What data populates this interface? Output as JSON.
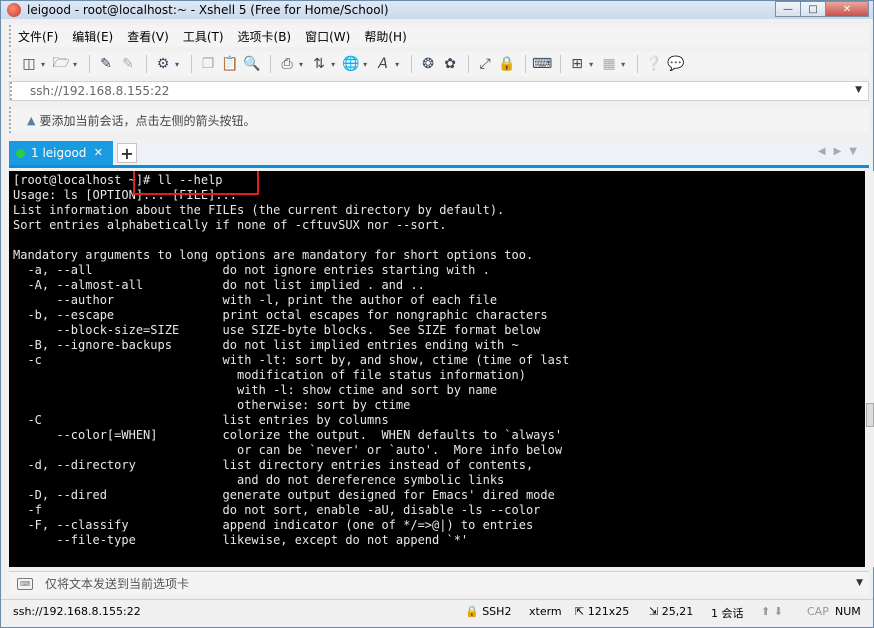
{
  "window": {
    "title": "leigood - root@localhost:~ - Xshell 5 (Free for Home/School)"
  },
  "menu": [
    "文件(F)",
    "编辑(E)",
    "查看(V)",
    "工具(T)",
    "选项卡(B)",
    "窗口(W)",
    "帮助(H)"
  ],
  "address": {
    "value": "ssh://192.168.8.155:22"
  },
  "hint": {
    "text": "要添加当前会话，点击左侧的箭头按钮。"
  },
  "tabs": [
    {
      "label": "1 leigood",
      "active": true
    }
  ],
  "terminal": {
    "lines": [
      "[root@localhost ~]# ll --help",
      "Usage: ls [OPTION]... [FILE]...",
      "List information about the FILEs (the current directory by default).",
      "Sort entries alphabetically if none of -cftuvSUX nor --sort.",
      "",
      "Mandatory arguments to long options are mandatory for short options too.",
      "  -a, --all                  do not ignore entries starting with .",
      "  -A, --almost-all           do not list implied . and ..",
      "      --author               with -l, print the author of each file",
      "  -b, --escape               print octal escapes for nongraphic characters",
      "      --block-size=SIZE      use SIZE-byte blocks.  See SIZE format below",
      "  -B, --ignore-backups       do not list implied entries ending with ~",
      "  -c                         with -lt: sort by, and show, ctime (time of last",
      "                               modification of file status information)",
      "                               with -l: show ctime and sort by name",
      "                               otherwise: sort by ctime",
      "  -C                         list entries by columns",
      "      --color[=WHEN]         colorize the output.  WHEN defaults to `always'",
      "                               or can be `never' or `auto'.  More info below",
      "  -d, --directory            list directory entries instead of contents,",
      "                               and do not dereference symbolic links",
      "  -D, --dired                generate output designed for Emacs' dired mode",
      "  -f                         do not sort, enable -aU, disable -ls --color",
      "  -F, --classify             append indicator (one of */=>@|) to entries",
      "      --file-type            likewise, except do not append `*'"
    ]
  },
  "compose": {
    "placeholder": "仅将文本发送到当前选项卡"
  },
  "status": {
    "connection": "ssh://192.168.8.155:22",
    "protocol": "SSH2",
    "terminal_type": "xterm",
    "size": "121x25",
    "cursor": "25,21",
    "sessions": "1 会话",
    "cap": "CAP",
    "num": "NUM"
  },
  "colors": {
    "tab_active": "#1a9ae0",
    "terminal_bg": "#000000",
    "terminal_fg": "#e8e8e8",
    "highlight": "#e02020"
  }
}
